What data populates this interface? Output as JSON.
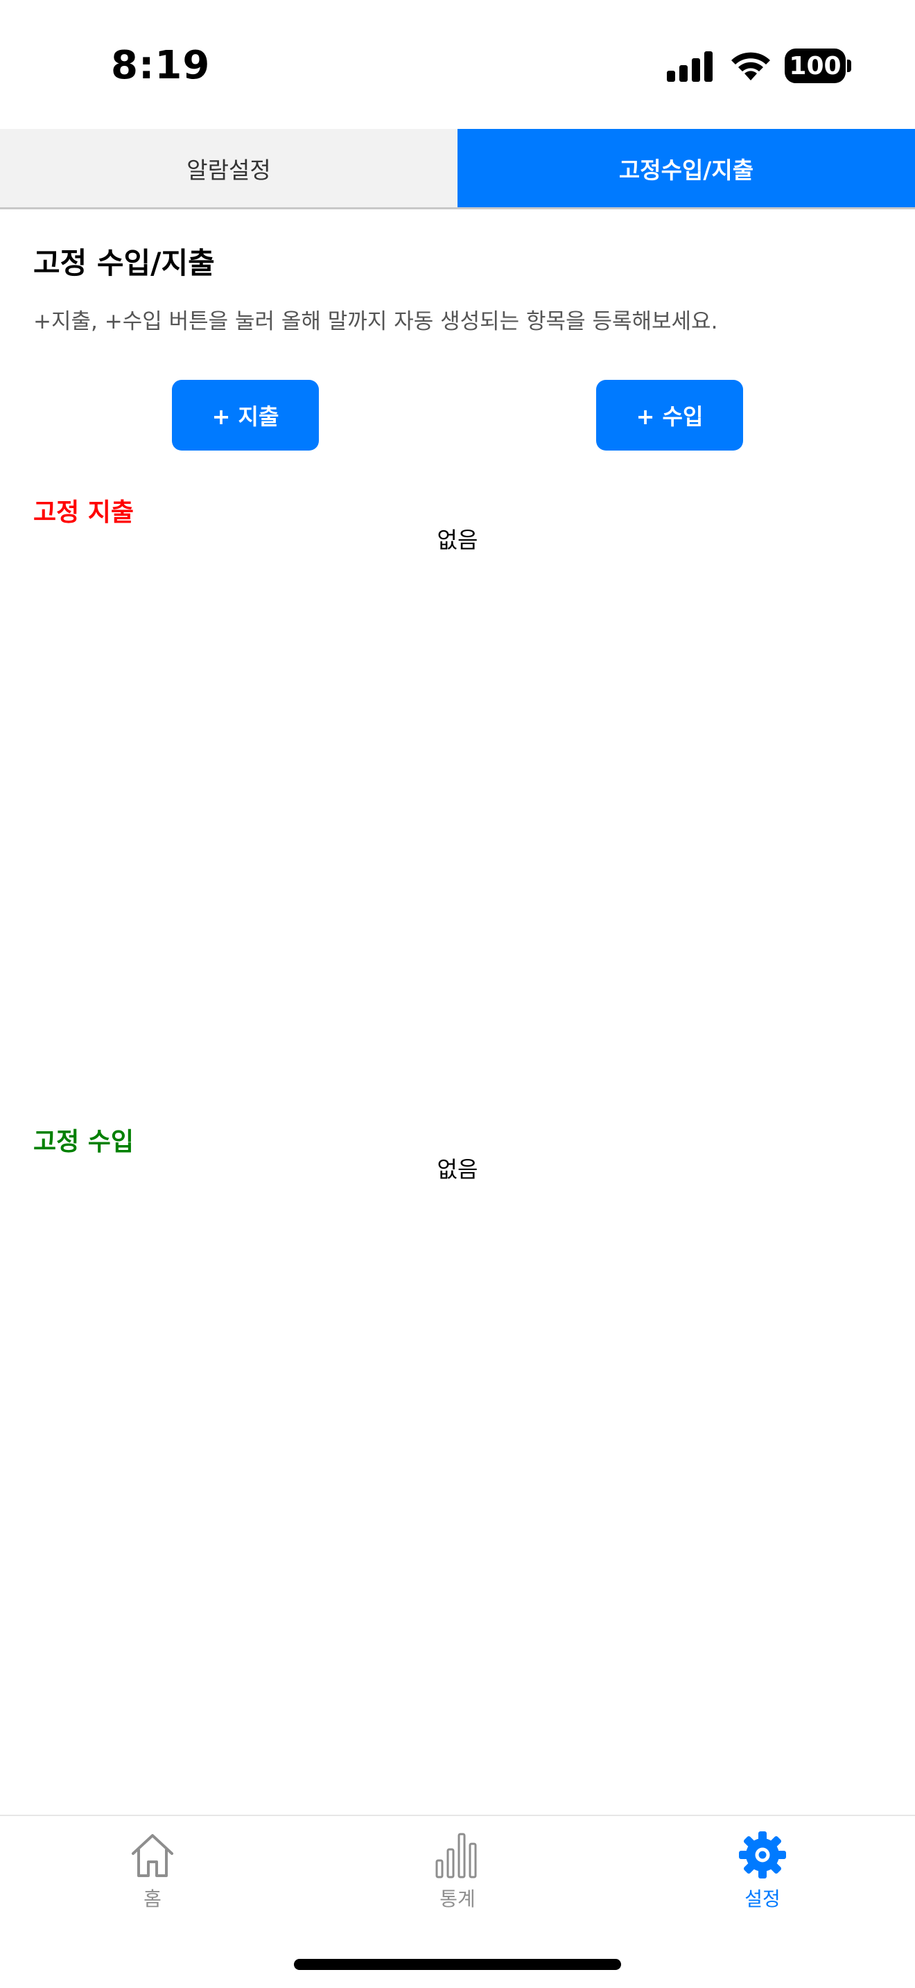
{
  "status_bar": {
    "time": "8:19",
    "battery": "100"
  },
  "tabs": [
    {
      "label": "알람설정",
      "active": false
    },
    {
      "label": "고정수입/지출",
      "active": true
    }
  ],
  "content": {
    "title": "고정 수입/지출",
    "description": "+지출, +수입 버튼을 눌러 올해 말까지 자동 생성되는 항목을 등록해보세요.",
    "expense_button_label": "+ 지출",
    "income_button_label": "+ 수입",
    "expense_section": {
      "title": "고정 지출",
      "empty_text": "없음"
    },
    "income_section": {
      "title": "고정 수입",
      "empty_text": "없음"
    }
  },
  "bottom_nav": [
    {
      "label": "홈",
      "icon": "home-icon",
      "active": false
    },
    {
      "label": "통계",
      "icon": "bar-chart-icon",
      "active": false
    },
    {
      "label": "설정",
      "icon": "gear-icon",
      "active": true
    }
  ],
  "colors": {
    "accent": "#007aff",
    "expense": "#ff0000",
    "income": "#008000",
    "inactive_tab_bg": "#f2f2f2",
    "nav_inactive": "#8e8e8e"
  }
}
